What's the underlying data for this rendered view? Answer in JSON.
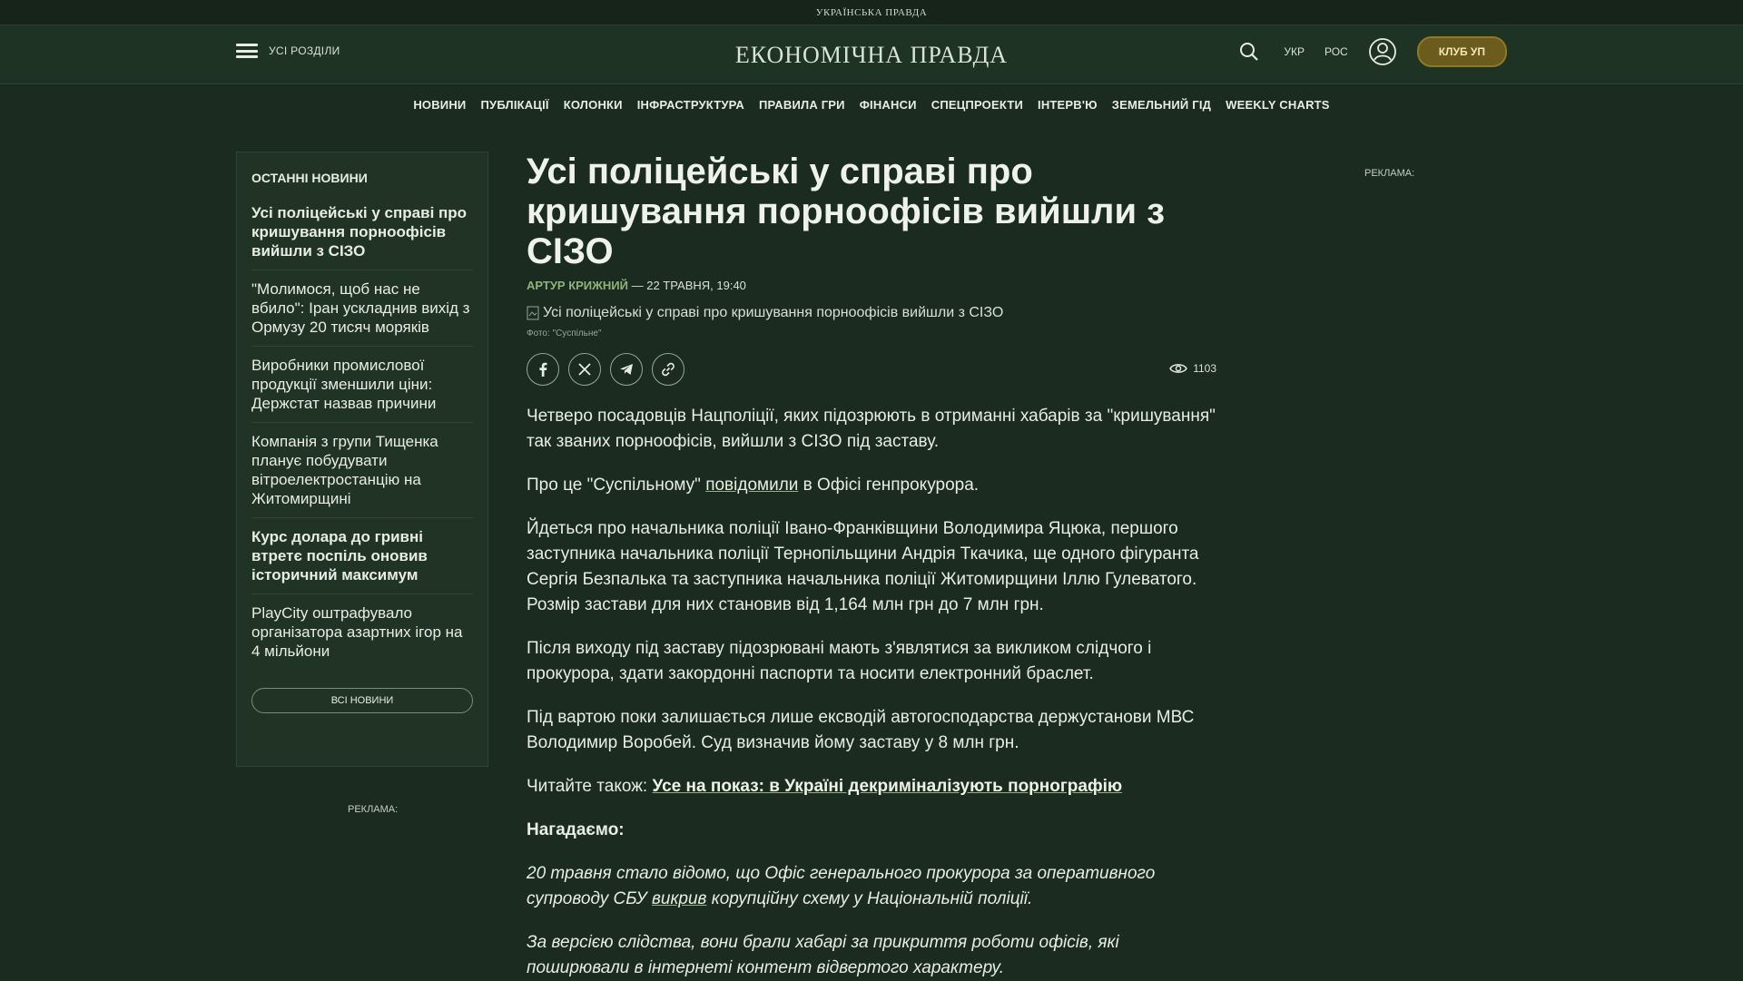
{
  "topstrip": {
    "label": "УКРАЇНСЬКА ПРАВДА"
  },
  "header": {
    "menu_label": "УСІ РОЗДІЛИ",
    "brand": "ЕКОНОМІЧНА ПРАВДА",
    "lang_ukr": "УКР",
    "lang_ros": "РОС",
    "club_label": "КЛУБ УП"
  },
  "nav": {
    "items": [
      {
        "label": "НОВИНИ"
      },
      {
        "label": "ПУБЛІКАЦІЇ"
      },
      {
        "label": "КОЛОНКИ"
      },
      {
        "label": "ІНФРАСТРУКТУРА"
      },
      {
        "label": "ПРАВИЛА ГРИ"
      },
      {
        "label": "ФІНАНСИ"
      },
      {
        "label": "СПЕЦПРОЕКТИ"
      },
      {
        "label": "ІНТЕРВ'Ю"
      },
      {
        "label": "ЗЕМЕЛЬНИЙ ГІД"
      },
      {
        "label": "WEEKLY CHARTS"
      }
    ]
  },
  "sidebar": {
    "title": "ОСТАННІ НОВИНИ",
    "items": [
      {
        "title": "Усі поліцейські у справі про кришування порноофісів вийшли з СІЗО",
        "bold": true
      },
      {
        "title": "\"Молимося, щоб нас не вбило\": Іран ускладнив вихід з Ормузу 20 тисяч моряків",
        "bold": false
      },
      {
        "title": "Виробники промислової продукції зменшили ціни: Держстат назвав причини",
        "bold": false
      },
      {
        "title": "Компанія з групи Тищенка планує побудувати вітроелектростанцію на Житомирщині",
        "bold": false
      },
      {
        "title": "Курс долара до гривні втретє поспіль оновив історичний максимум",
        "bold": true
      },
      {
        "title": "PlayCity оштрафувало організатора азартних ігор на 4 мільйони",
        "bold": false
      }
    ],
    "all_news_label": "ВСІ НОВИНИ",
    "ad_label": "РЕКЛАМА:"
  },
  "right_ad": {
    "label": "РЕКЛАМА:"
  },
  "article": {
    "title": "Усі поліцейські у справі про кришування порноофісів вийшли з СІЗО",
    "author": "АРТУР КРИЖНИЙ",
    "date": "— 22 ТРАВНЯ, 19:40",
    "image_alt": "Усі поліцейські у справі про кришування порноофісів вийшли з СІЗО",
    "photo_caption": "Фото: \"Суспільне\"",
    "views": "1103",
    "p1": "Четверо посадовців Нацполіції, яких підозрюють в отриманні хабарів за \"кришування\" так званих порноофісів, вийшли з СІЗО під заставу.",
    "p2_before": "Про це \"Суспільному\" ",
    "p2_link": "повідомили",
    "p2_after": " в Офісі генпрокурора.",
    "p3": "Йдеться про начальника поліції Івано-Франківщини Володимира Яцюка, першого заступника начальника поліції Тернопільщини Андрія Ткачика, ще одного фігуранта Сергія Безпалька та заступника начальника поліції Житомирщини Іллю Гулеватого. Розмір застави для них становив від 1,164 млн грн до 7 млн грн.",
    "p4": "Після виходу під заставу підозрювані мають з'являтися за викликом слідчого і прокурора, здати закордонні паспорти та носити електронний браслет.",
    "p5": "Під вартою поки залишається лише ексводій автогосподарства держустанови МВС Володимир Воробей. Суд визначив йому заставу у 8 млн грн.",
    "read_also_label": "Читайте також: ",
    "read_also_link": "Усе на показ: в Україні декриміналізують порнографію",
    "reminder": "Нагадаємо:",
    "p6_before": "20 травня стало відомо, що Офіс генерального прокурора за оперативного супроводу СБУ ",
    "p6_link": "викрив",
    "p6_after": " корупційну схему у Національній поліції.",
    "p7": "За версією слідства, вони брали хабарі за прикриття роботи офісів, які поширювали в інтернеті контент відвертого характеру."
  }
}
